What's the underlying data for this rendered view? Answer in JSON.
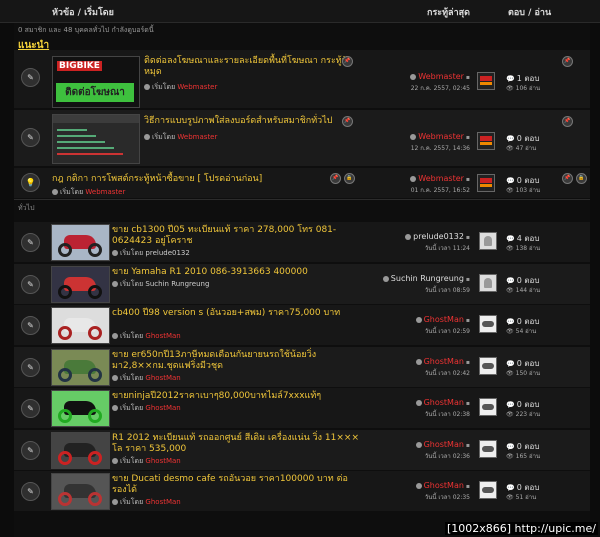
{
  "header": {
    "topic_by": "หัวข้อ / เริ่มโดย",
    "last_post": "กระทู้ล่าสุด",
    "replies_reads": "ตอบ / อ่าน"
  },
  "counter": "0 สมาชิก และ 48 บุคคลทั่วไป กำลังดูบอร์ดนี้",
  "section_featured": "แนะนำ",
  "section_general": "ทั่วไป",
  "by_prefix": "เริ่มโดย",
  "pinned": [
    {
      "title": "ติดต่อลงโฆษณาและรายละเอียดพื้นที่โฆษณา กระทู้ปักหมุด",
      "author": "Webmaster",
      "last_user": "Webmaster",
      "last_time": "22 ก.ค. 2557, 02:45",
      "replies": "1 ตอบ",
      "views": "106 อ่าน",
      "thumb_line1": "BIGBIKE",
      "thumb_line2": "ติดต่อโฆษณา"
    },
    {
      "title": "วิธีการแบบรูปภาพใส่ลงบอร์ดสำหรับสมาชิกทั่วไป",
      "author": "Webmaster",
      "last_user": "Webmaster",
      "last_time": "12 ก.ค. 2557, 14:36",
      "replies": "0 ตอบ",
      "views": "47 อ่าน"
    },
    {
      "title": "กฎ กติกา การโพสต์กระทู้หน้าซื้อขาย [ โปรดอ่านก่อน]",
      "author": "Webmaster",
      "last_user": "Webmaster",
      "last_time": "01 ก.ค. 2557, 16:52",
      "replies": "0 ตอบ",
      "views": "103 อ่าน"
    }
  ],
  "topics": [
    {
      "title": "ขาย cb1300 ปี05 ทะเบียนแท้ ราคา 278,000 โทร 081-0624423 อยู่โคราช",
      "author": "prelude0132",
      "author_red": false,
      "last_user": "prelude0132",
      "last_time": "วันนี้ เวลา 11:24",
      "replies": "4 ตอบ",
      "views": "138 อ่าน",
      "colors": [
        "#a9b6c6",
        "#222",
        "#b23"
      ]
    },
    {
      "title": "ขาย Yamaha R1 2010 086-3913663 400000",
      "author": "Suchin Rungreung",
      "author_red": false,
      "last_user": "Suchin Rungreung",
      "last_time": "วันนี้ เวลา 08:59",
      "replies": "0 ตอบ",
      "views": "144 อ่าน",
      "colors": [
        "#334",
        "#111",
        "#c33"
      ]
    },
    {
      "title": "cb400 ปี98 version s (อันวอย+สพม) ราคา75,000 บาท",
      "author": "GhostMan",
      "author_red": true,
      "last_user": "GhostMan",
      "last_time": "วันนี้ เวลา 02:59",
      "replies": "0 ตอบ",
      "views": "54 อ่าน",
      "colors": [
        "#ddd",
        "#a22",
        "#e8e8e8"
      ]
    },
    {
      "title": "ขาย er650nปี13ภาษีหมดเดือนกันยายนรถใช้น้อยวิ่งมา2,8××กม.ชุดแฟริ่งมีวชุด",
      "author": "GhostMan",
      "author_red": true,
      "last_user": "GhostMan",
      "last_time": "วันนี้ เวลา 02:42",
      "replies": "0 ตอบ",
      "views": "150 อ่าน",
      "colors": [
        "#7a8a55",
        "#234",
        "#4a7a3a"
      ]
    },
    {
      "title": "ขายninjaปี2012ราคาเบาๆ80,000บาทไมล์7xxxแท้ๆ",
      "author": "GhostMan",
      "author_red": true,
      "last_user": "GhostMan",
      "last_time": "วันนี้ เวลา 02:38",
      "replies": "0 ตอบ",
      "views": "223 อ่าน",
      "colors": [
        "#6c6",
        "#2a2",
        "#111"
      ]
    },
    {
      "title": "R1 2012 ทะเบียนแท้ รถออกศูนย์ สีเดิม เครื่องแน่น วิ่ง 11××× โล ราคา 535,000",
      "author": "GhostMan",
      "author_red": true,
      "last_user": "GhostMan",
      "last_time": "วันนี้ เวลา 02:36",
      "replies": "0 ตอบ",
      "views": "165 อ่าน",
      "colors": [
        "#444",
        "#c22",
        "#222"
      ]
    },
    {
      "title": "ขาย Ducati desmo cafe รถอันวอย ราคา100000 บาท ต่อรองได้",
      "author": "GhostMan",
      "author_red": true,
      "last_user": "GhostMan",
      "last_time": "วันนี้ เวลา 02:35",
      "replies": "0 ตอบ",
      "views": "51 อ่าน",
      "colors": [
        "#555",
        "#b33",
        "#333"
      ]
    }
  ],
  "watermark": "[1002x866] http://upic.me/",
  "icons": {
    "topic": "pencil-icon",
    "rules": "lightbulb-icon",
    "user": "user-icon",
    "new": "new-post-icon",
    "replies": "comment-icon",
    "views": "eye-icon"
  }
}
